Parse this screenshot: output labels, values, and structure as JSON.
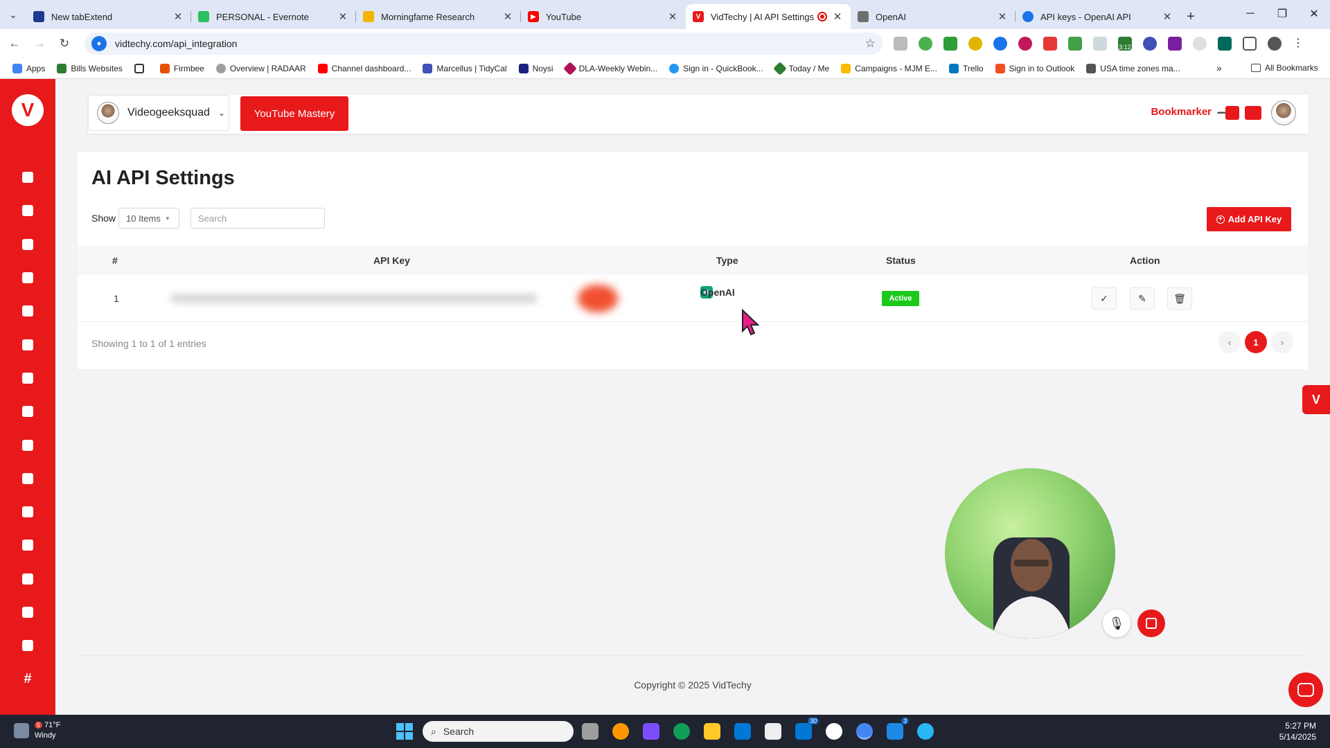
{
  "browser": {
    "tabs": [
      {
        "title": "New tabExtend",
        "color": "#1b3b8f"
      },
      {
        "title": "PERSONAL - Evernote",
        "color": "#2dbe60"
      },
      {
        "title": "Morningfame Research",
        "color": "#f5b400"
      },
      {
        "title": "YouTube",
        "color": "#ff0000"
      },
      {
        "title": "VidTechy | AI API Settings",
        "color": "#e8191b",
        "active": true
      },
      {
        "title": "OpenAI",
        "color": "#6e6e6e"
      },
      {
        "title": "API keys - OpenAI API",
        "color": "#1a73e8"
      }
    ],
    "url": "vidtechy.com/api_integration",
    "bookmarks": [
      "Apps",
      "Bills Websites",
      "Firmbee",
      "Overview | RADAAR",
      "Channel dashboard...",
      "Marcellus | TidyCal",
      "Noysi",
      "DLA-Weekly Webin...",
      "Sign in - QuickBook...",
      "Today / Me",
      "Campaigns - MJM E...",
      "Trello",
      "Sign in to Outlook",
      "USA time zones ma..."
    ],
    "all_bookmarks": "All Bookmarks",
    "ext_badge": "3:12"
  },
  "header": {
    "workspace": "Videogeeksquad",
    "youtube_mastery": "YouTube Mastery",
    "bookmarker": "Bookmarker"
  },
  "page": {
    "title": "AI API Settings",
    "show_label": "Show",
    "page_size": "10 Items",
    "search_placeholder": "Search",
    "add_button": "Add API Key",
    "columns": {
      "num": "#",
      "key": "API Key",
      "type": "Type",
      "status": "Status",
      "action": "Action"
    },
    "rows": [
      {
        "num": "1",
        "type": "OpenAI",
        "status": "Active"
      }
    ],
    "showing": "Showing 1 to 1 of 1 entries",
    "pagination": {
      "prev": "‹",
      "current": "1",
      "next": "›"
    }
  },
  "footer": {
    "copyright": "Copyright © 2025 VidTechy"
  },
  "taskbar": {
    "temp": "71°F",
    "condition": "Windy",
    "weather_badge": "5",
    "search": "Search",
    "outlook_badge": "30",
    "messenger_badge": "3",
    "time": "5:27 PM",
    "date": "5/14/2025"
  }
}
